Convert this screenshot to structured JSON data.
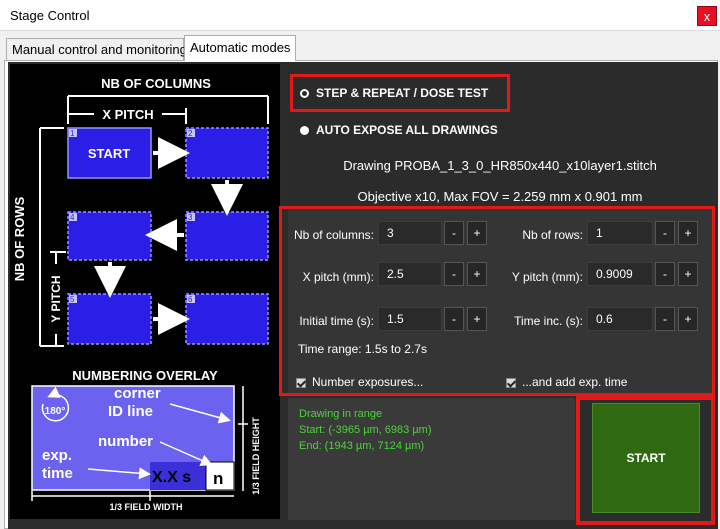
{
  "window": {
    "title": "Stage Control",
    "close_label": "x"
  },
  "tabs": [
    {
      "label": "Manual control and monitoring",
      "active": false
    },
    {
      "label": "Automatic modes",
      "active": true
    }
  ],
  "mode_options": [
    {
      "label": "STEP & REPEAT / DOSE TEST",
      "selected": false
    },
    {
      "label": "AUTO EXPOSE ALL DRAWINGS",
      "selected": true
    }
  ],
  "drawing_info": "Drawing PROBA_1_3_0_HR850x440_x10layer1.stitch",
  "objective_info": "Objective x10, Max FOV = 2.259 mm x 0.901 mm",
  "settings": {
    "nb_columns": {
      "label": "Nb of columns:",
      "value": "3"
    },
    "nb_rows": {
      "label": "Nb of rows:",
      "value": "1"
    },
    "x_pitch": {
      "label": "X pitch (mm):",
      "value": "2.5"
    },
    "y_pitch": {
      "label": "Y pitch (mm):",
      "value": "0.9009"
    },
    "initial_time": {
      "label": "Initial time (s):",
      "value": "1.5"
    },
    "time_inc": {
      "label": "Time inc. (s):",
      "value": "0.6"
    },
    "minus": "-",
    "plus": "+",
    "time_range": "Time range: 1.5s to 2.7s",
    "number_exposures": {
      "label": "Number exposures...",
      "checked": true
    },
    "add_exp_time": {
      "label": "...and add exp. time",
      "checked": true
    }
  },
  "status": {
    "line1": "Drawing in range",
    "line2": "Start: (-3965 µm, 6983 µm)",
    "line3": "End: (1943 µm, 7124 µm)"
  },
  "start_button": "START",
  "diagram": {
    "nb_columns": "NB OF COLUMNS",
    "x_pitch": "X PITCH",
    "nb_rows": "NB OF ROWS",
    "y_pitch": "Y PITCH",
    "start": "START",
    "cells": [
      "1",
      "2",
      "3",
      "4",
      "5",
      "6"
    ],
    "numbering_overlay": "NUMBERING OVERLAY",
    "rotation": "180°",
    "corner": "corner",
    "id_line": "ID line",
    "number": "number",
    "exp": "exp.",
    "time": "time",
    "xxs": "X.X s",
    "n": "n",
    "field_height": "1/3 FIELD HEIGHT",
    "field_width": "1/3 FIELD WIDTH"
  },
  "colors": {
    "accent_red": "#e01a1a",
    "start_green": "#2f6a10",
    "status_green": "#4dd43a",
    "cell_blue": "#2b1ee6",
    "overlay_blue": "#6b63f0"
  }
}
